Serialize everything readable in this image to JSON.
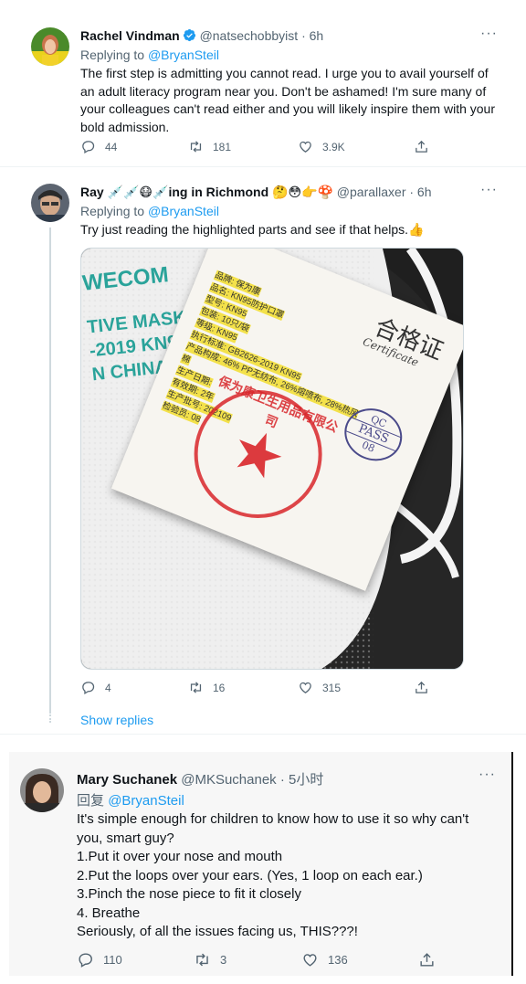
{
  "tweets": [
    {
      "name": "Rachel Vindman",
      "handle": "@natsechobbyist",
      "time": "· 6h",
      "replying_prefix": "Replying to",
      "replying_to": "@BryanSteil",
      "text": "The first step is admitting you cannot read. I urge you to avail yourself of an adult literacy program near you. Don't be ashamed! I'm sure many of your colleagues can't read either and you will likely inspire them with your bold admission.",
      "replies": "44",
      "retweets": "181",
      "likes": "3.9K"
    },
    {
      "name": "Ray 💉💉😷💉ing in Richmond 🤔😳👉🍄",
      "handle": "@parallaxer",
      "time": "· 6h",
      "replying_prefix": "Replying to",
      "replying_to": "@BryanSteil",
      "text": "Try just reading the highlighted parts and see if that helps.👍",
      "image": {
        "mask_print": [
          "WECOM",
          "TIVE MASK",
          "-2019 KN95",
          "N CHINA"
        ],
        "cert_title": "合格证",
        "cert_subtitle": "Certificate",
        "qc_label": "QC",
        "pass_label": "PASS",
        "qc_number": "08",
        "cert_lines": [
          "品牌: 保为康",
          "品名: KN95防护口罩",
          "型号: KN95",
          "包装: 10只/袋",
          "等级: KN95",
          "执行标准: GB2626-2019 KN95",
          "产品构成: 46% PP无纺布, 26%熔喷布, 28%热风棉",
          "生产日期:",
          "有效期: 2年",
          "生产批号: 202109",
          "检验员: 08"
        ],
        "stamp_text": "保为康卫生用品有限公司"
      },
      "replies": "4",
      "retweets": "16",
      "likes": "315",
      "show_replies": "Show replies"
    },
    {
      "name": "Mary Suchanek",
      "handle": "@MKSuchanek",
      "time": "· 5小时",
      "replying_prefix": "回复",
      "replying_to": "@BryanSteil",
      "text_lines": [
        "It's simple enough for children to know how to use it so why can't",
        "you, smart guy?",
        "1.Put it over your nose and mouth",
        "2.Put the loops over your ears. (Yes, 1 loop on each ear.)",
        "3.Pinch the nose piece to fit it closely",
        "4. Breathe",
        "Seriously, of all the issues facing us, THIS???!"
      ],
      "replies": "110",
      "retweets": "3",
      "likes": "136"
    }
  ],
  "icons": {
    "reply": "reply-icon",
    "retweet": "retweet-icon",
    "like": "heart-icon",
    "share": "share-icon",
    "more": "more-icon",
    "verified": "verified-badge-icon"
  },
  "colors": {
    "accent": "#1d9bf0",
    "muted": "#536471",
    "text": "#0f1419",
    "highlight": "#f3e14a"
  }
}
